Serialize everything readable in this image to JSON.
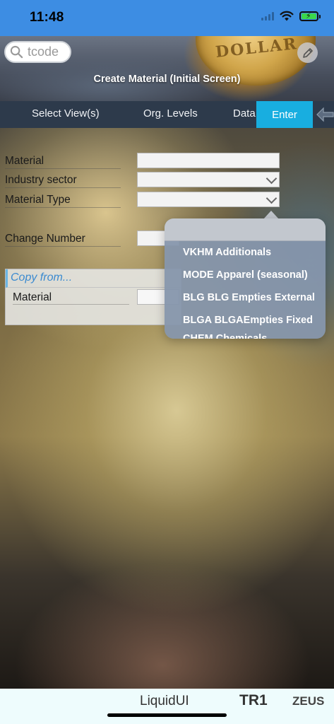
{
  "status_bar": {
    "time": "11:48"
  },
  "header": {
    "tcode_placeholder": "tcode",
    "title": "Create Material (Initial Screen)",
    "coin_text": "DOLLAR",
    "icons": [
      "search-icon",
      "pencil-icon"
    ]
  },
  "toolbar": {
    "select_views": "Select View(s)",
    "org_levels": "Org. Levels",
    "data": "Data",
    "enter": "Enter"
  },
  "form": {
    "material_label": "Material",
    "industry_sector_label": "Industry sector",
    "material_type_label": "Material Type",
    "change_number_label": "Change Number",
    "material_value": "",
    "industry_sector_value": "",
    "material_type_value": "",
    "change_number_value": ""
  },
  "copy_from": {
    "title": "Copy from...",
    "material_label": "Material",
    "material_value": ""
  },
  "dropdown": {
    "items": [
      "VKHM Additionals",
      "MODE Apparel (seasonal)",
      "BLG BLG Empties External",
      "BLGA BLGAEmpties Fixed",
      "CHEM Chemicals"
    ]
  },
  "footer": {
    "app": "LiquidUI",
    "system": "TR1",
    "server": "ZEUS"
  },
  "colors": {
    "status_bar": "#3d8de3",
    "toolbar": "#2d3a4b",
    "enter_button": "#18aee0",
    "copy_title": "#3a8ad0",
    "footer": "#eefcfd"
  }
}
